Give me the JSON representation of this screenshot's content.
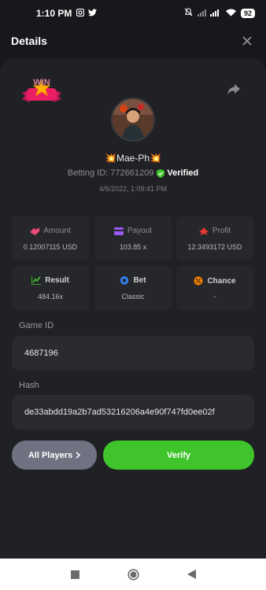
{
  "status": {
    "time": "1:10 PM",
    "battery": "92"
  },
  "header": {
    "title": "Details"
  },
  "player": {
    "name": "Mae-Ph",
    "spark": "💥",
    "betting_id_label": "Betting ID: 772661209",
    "verified_label": "Verified",
    "date": "4/6/2022, 1:09:41 PM"
  },
  "badge": {
    "text": "WIN"
  },
  "stats": {
    "amount": {
      "label": "Amount",
      "value": "0.12007115 USD"
    },
    "payout": {
      "label": "Payout",
      "value": "103.85 x"
    },
    "profit": {
      "label": "Profit",
      "value": "12.3493172 USD"
    },
    "result": {
      "label": "Result",
      "value": "484.16x"
    },
    "bet": {
      "label": "Bet",
      "value": "Classic"
    },
    "chance": {
      "label": "Chance",
      "value": "-"
    }
  },
  "game_id": {
    "label": "Game ID",
    "value": "4687196"
  },
  "hash": {
    "label": "Hash",
    "value": "de33abdd19a2b7ad53216206a4e90f747fd0ee02f"
  },
  "buttons": {
    "all_players": "All Players",
    "verify": "Verify"
  },
  "colors": {
    "accent_green": "#3fc42b",
    "background": "#17181b",
    "card": "#202124"
  },
  "icons": [
    "photo-icon",
    "twitter-icon",
    "mute-icon",
    "signal-icon",
    "wifi-icon",
    "close-icon",
    "share-icon",
    "amount-icon",
    "payout-icon",
    "profit-icon",
    "result-icon",
    "bet-icon",
    "chance-icon",
    "verified-shield-icon"
  ]
}
